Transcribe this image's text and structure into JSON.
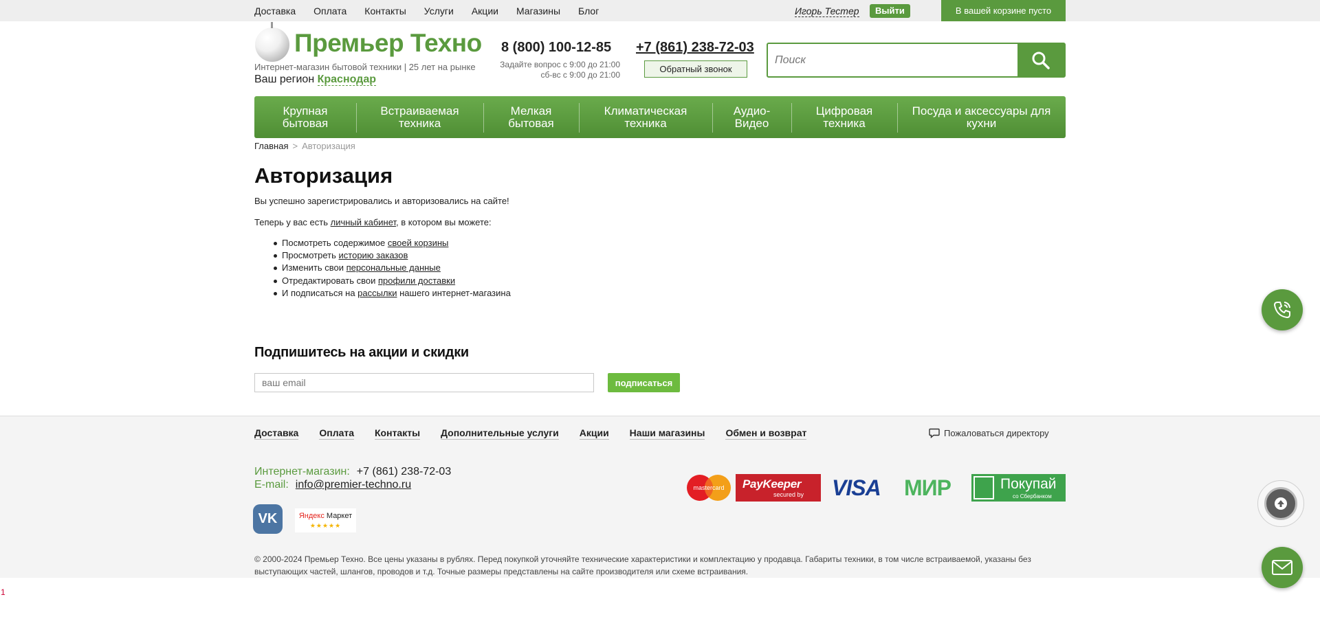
{
  "top_nav": [
    "Доставка",
    "Оплата",
    "Контакты",
    "Услуги",
    "Акции",
    "Магазины",
    "Блог"
  ],
  "user": {
    "name": "Игорь Тестер",
    "logout": "Выйти"
  },
  "cart": {
    "label": "В вашей корзине пусто"
  },
  "header": {
    "logo": "Премьер Техно",
    "tagline": "Интернет-магазин бытовой техники | 25 лет на рынке",
    "region_label": "Ваш регион",
    "region_city": "Краснодар",
    "phone_free": "8 (800) 100-12-85",
    "hours_1": "Задайте вопрос с 9:00 до 21:00",
    "hours_2": "сб-вс с 9:00 до 21:00",
    "phone_local": "+7 (861) 238-72-03",
    "callback": "Обратный звонок"
  },
  "search": {
    "placeholder": "Поиск",
    "icon": "search-icon"
  },
  "menu": [
    {
      "label": "Крупная бытовая"
    },
    {
      "label": "Встраиваемая техника"
    },
    {
      "label": "Мелкая бытовая"
    },
    {
      "label": "Климатическая техника"
    },
    {
      "label": "Аудио-Видео"
    },
    {
      "label": "Цифровая техника"
    },
    {
      "label": "Посуда и аксессуары для кухни"
    }
  ],
  "breadcrumb": {
    "home": "Главная",
    "separator": ">",
    "current": "Авторизация"
  },
  "content": {
    "title": "Авторизация",
    "success": "Вы успешно зарегистрировались и авторизовались на сайте!",
    "intro_before": "Теперь у вас есть ",
    "intro_link": "личный кабинет",
    "intro_after": ", в котором вы можете:",
    "actions": [
      {
        "before": "Посмотреть содержимое ",
        "link": "своей корзины",
        "after": ""
      },
      {
        "before": "Просмотреть ",
        "link": "историю заказов",
        "after": ""
      },
      {
        "before": "Изменить свои ",
        "link": "персональные данные",
        "after": ""
      },
      {
        "before": "Отредактировать свои ",
        "link": "профили доставки",
        "after": ""
      },
      {
        "before": "И подписаться на ",
        "link": "рассылки",
        "after": " нашего интернет-магазина"
      }
    ]
  },
  "subscribe": {
    "title": "Подпишитесь на акции и скидки",
    "placeholder": "ваш email",
    "button": "подписаться"
  },
  "footer": {
    "nav": [
      "Доставка",
      "Оплата",
      "Контакты",
      "Дополнительные услуги",
      "Акции",
      "Наши магазины",
      "Обмен и возврат"
    ],
    "complain": "Пожаловаться директору",
    "shop_label": "Интернет-магазин:",
    "shop_phone": "+7 (861) 238-72-03",
    "email_label": "E-mail:",
    "email": "info@premier-techno.ru",
    "social": {
      "vk": "vk-icon",
      "yandex_market_1": "Яндекс",
      "yandex_market_2": "Маркет",
      "yandex_stars": "★★★★★"
    },
    "payments": {
      "mastercard": "mastercard",
      "paykeeper": "PayKeeper",
      "paykeeper_sub": "secured by",
      "visa": "VISA",
      "mir": "МИР",
      "sber": "Покупай",
      "sber_sub": "со Сбербанком"
    },
    "legal": "© 2000-2024 Премьер Техно. Все цены указаны в рублях.  Перед покупкой уточняйте технические характеристики и комплектацию у продавца. Габариты техники, в том числе встраиваемой, указаны без выступающих частей, шлангов, проводов и т.д. Точные размеры представлены на сайте производителя или схеме встраивания."
  },
  "page_number": "1",
  "colors": {
    "brand_green": "#5a9a3e",
    "light_green_button": "#6dbb3f",
    "topbar_bg": "#eeeeee",
    "footer_bg": "#f4f4f4"
  }
}
